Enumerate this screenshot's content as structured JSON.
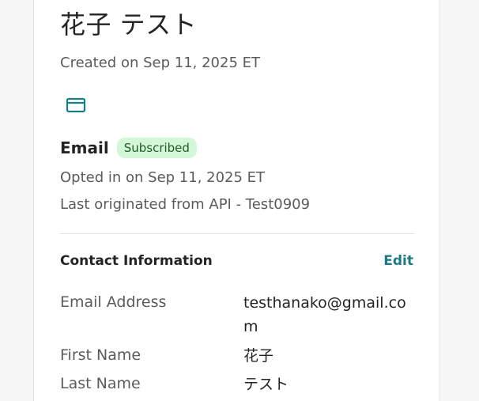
{
  "contact": {
    "name": "花子 テスト",
    "created": "Created on Sep 11, 2025 ET"
  },
  "email_channel": {
    "title": "Email",
    "status": "Subscribed",
    "opted_in": "Opted in on Sep 11, 2025 ET",
    "last_originated": "Last originated from API - Test0909"
  },
  "contact_info": {
    "title": "Contact Information",
    "edit_label": "Edit",
    "fields": [
      {
        "label": "Email Address",
        "value": "testhanako@gmail.com"
      },
      {
        "label": "First Name",
        "value": "花子"
      },
      {
        "label": "Last Name",
        "value": "テスト"
      }
    ]
  },
  "colors": {
    "accent": "#1a7b84",
    "badge_bg": "#d3f7d7",
    "badge_text": "#1f5c2c"
  },
  "icons": {
    "email_channel": "envelope-icon"
  }
}
